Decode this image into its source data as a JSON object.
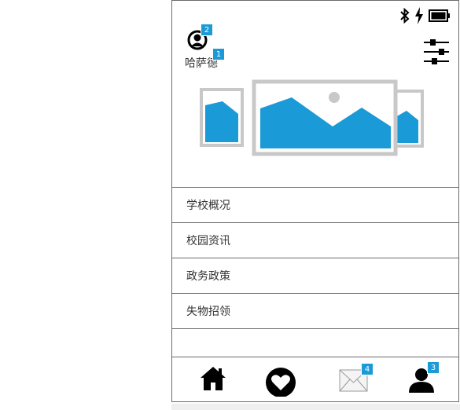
{
  "status_bar": {
    "icons": [
      "bluetooth-icon",
      "charging-icon",
      "battery-icon"
    ]
  },
  "profile": {
    "username": "哈萨德",
    "avatar_badge": "2",
    "username_badge": "1"
  },
  "carousel": {
    "slides": [
      "image-placeholder",
      "image-placeholder",
      "image-placeholder"
    ]
  },
  "menu": {
    "items": [
      {
        "label": "学校概况"
      },
      {
        "label": "校园资讯"
      },
      {
        "label": "政务政策"
      },
      {
        "label": "失物招领"
      },
      {
        "label": ""
      }
    ]
  },
  "tabbar": {
    "tabs": [
      {
        "icon": "home-icon",
        "badge": ""
      },
      {
        "icon": "heart-icon",
        "badge": ""
      },
      {
        "icon": "mail-icon",
        "badge": "4"
      },
      {
        "icon": "user-icon",
        "badge": "3"
      }
    ]
  },
  "colors": {
    "accent": "#1a9ad6",
    "frame": "#6b6b6b",
    "placeholder_border": "#c8c8c8"
  }
}
